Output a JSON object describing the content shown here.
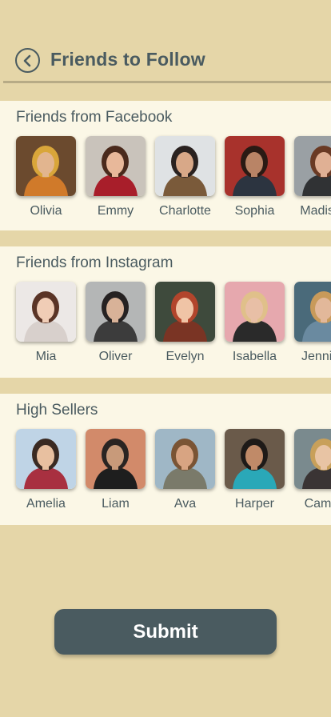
{
  "header": {
    "title": "Friends to Follow",
    "back_icon": "chevron-left-circle-icon"
  },
  "sections": [
    {
      "title": "Friends from Facebook",
      "friends": [
        {
          "name": "Olivia",
          "bg": "#6b4a2e",
          "skin": "#e2b58f",
          "hair": "#d9a63a",
          "shirt": "#d07a2a"
        },
        {
          "name": "Emmy",
          "bg": "#c9c3bb",
          "skin": "#e8b89a",
          "hair": "#4a2a1c",
          "shirt": "#a81e2a"
        },
        {
          "name": "Charlotte",
          "bg": "#dfe2e4",
          "skin": "#d8a888",
          "hair": "#2a2220",
          "shirt": "#7a5a3a"
        },
        {
          "name": "Sophia",
          "bg": "#a8322c",
          "skin": "#b98466",
          "hair": "#2a1a14",
          "shirt": "#2c3440"
        },
        {
          "name": "Madison",
          "bg": "#9aa0a4",
          "skin": "#e0b094",
          "hair": "#6a3a24",
          "shirt": "#303234"
        }
      ]
    },
    {
      "title": "Friends from Instagram",
      "friends": [
        {
          "name": "Mia",
          "bg": "#ece8e6",
          "skin": "#f0cdb6",
          "hair": "#5a3426",
          "shirt": "#d8d0cc"
        },
        {
          "name": "Oliver",
          "bg": "#b4b6b6",
          "skin": "#d8b298",
          "hair": "#262222",
          "shirt": "#3c3c3c"
        },
        {
          "name": "Evelyn",
          "bg": "#3e4a3c",
          "skin": "#f0c4a6",
          "hair": "#b2452c",
          "shirt": "#7a3424"
        },
        {
          "name": "Isabella",
          "bg": "#e6a8ae",
          "skin": "#e8bfa6",
          "hair": "#e0c08a",
          "shirt": "#2a2a2a"
        },
        {
          "name": "Jennifer",
          "bg": "#4a6a7a",
          "skin": "#e2b89a",
          "hair": "#c89a5a",
          "shirt": "#6a8aa0"
        }
      ]
    },
    {
      "title": "High Sellers",
      "friends": [
        {
          "name": "Amelia",
          "bg": "#bfd4e6",
          "skin": "#e8c0a0",
          "hair": "#3a2a22",
          "shirt": "#a83040"
        },
        {
          "name": "Liam",
          "bg": "#d28a6a",
          "skin": "#c89a7a",
          "hair": "#2a2422",
          "shirt": "#1e1e1e"
        },
        {
          "name": "Ava",
          "bg": "#9fb7c6",
          "skin": "#d8a482",
          "hair": "#7a5434",
          "shirt": "#7a7a6a"
        },
        {
          "name": "Harper",
          "bg": "#6a5a4a",
          "skin": "#c08a68",
          "hair": "#1e1a18",
          "shirt": "#2aa8b8"
        },
        {
          "name": "Camila",
          "bg": "#7a8a8e",
          "skin": "#e8c4a4",
          "hair": "#c8a05a",
          "shirt": "#3a3434"
        }
      ]
    }
  ],
  "submit": {
    "label": "Submit"
  }
}
